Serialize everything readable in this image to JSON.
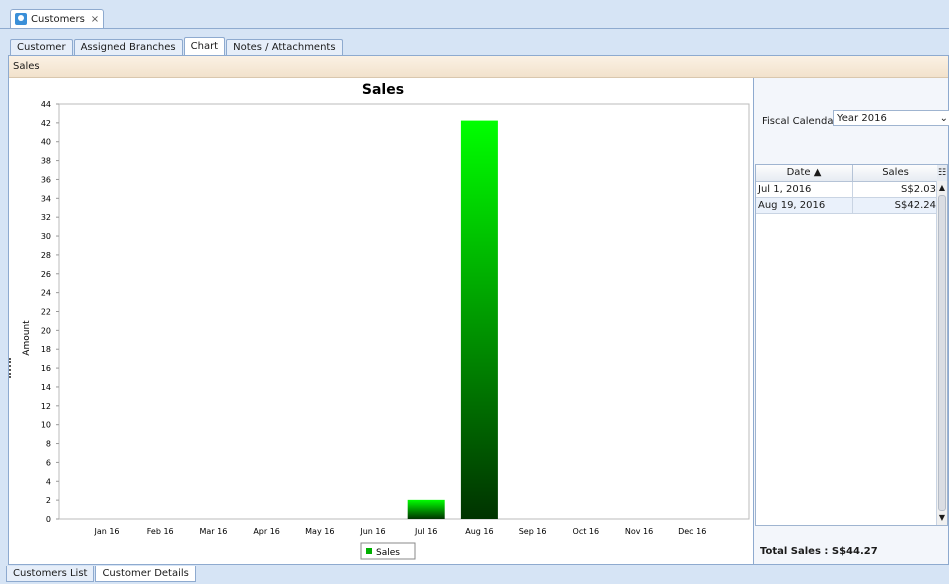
{
  "window": {
    "doc_tab_label": "Customers",
    "doc_tab_close": "×"
  },
  "tabs": [
    {
      "label": "Customer",
      "active": false
    },
    {
      "label": "Assigned Branches",
      "active": false
    },
    {
      "label": "Chart",
      "active": true
    },
    {
      "label": "Notes / Attachments",
      "active": false
    }
  ],
  "section_header": "Sales",
  "chart_data": {
    "type": "bar",
    "title": "Sales",
    "ylabel": "Amount",
    "xlabel": "",
    "categories": [
      "Jan 16",
      "Feb 16",
      "Mar 16",
      "Apr 16",
      "May 16",
      "Jun 16",
      "Jul 16",
      "Aug 16",
      "Sep 16",
      "Oct 16",
      "Nov 16",
      "Dec 16"
    ],
    "series": [
      {
        "name": "Sales",
        "values": [
          0,
          0,
          0,
          0,
          0,
          0,
          2.03,
          42.24,
          0,
          0,
          0,
          0
        ]
      }
    ],
    "ylim": [
      0,
      44
    ],
    "yticks": [
      0,
      2,
      4,
      6,
      8,
      10,
      12,
      14,
      16,
      18,
      20,
      22,
      24,
      26,
      28,
      30,
      32,
      34,
      36,
      38,
      40,
      42,
      44
    ],
    "grid": false,
    "legend": "bottom-center",
    "colors": {
      "bar_top": "#00ff00",
      "bar_bottom": "#003300",
      "legend_swatch": "#00b000"
    }
  },
  "side": {
    "fiscal_label": "Fiscal Calendar:",
    "fiscal_value": "Year 2016",
    "grid_headers": {
      "date": "Date ▲",
      "sales": "Sales"
    },
    "rows": [
      {
        "date": "Jul 1, 2016",
        "sales": "S$2.03"
      },
      {
        "date": "Aug 19, 2016",
        "sales": "S$42.24"
      }
    ],
    "total_label": "Total Sales : S$44.27"
  },
  "bottom_tabs": [
    {
      "label": "Customers List",
      "active": false
    },
    {
      "label": "Customer Details",
      "active": true
    }
  ]
}
